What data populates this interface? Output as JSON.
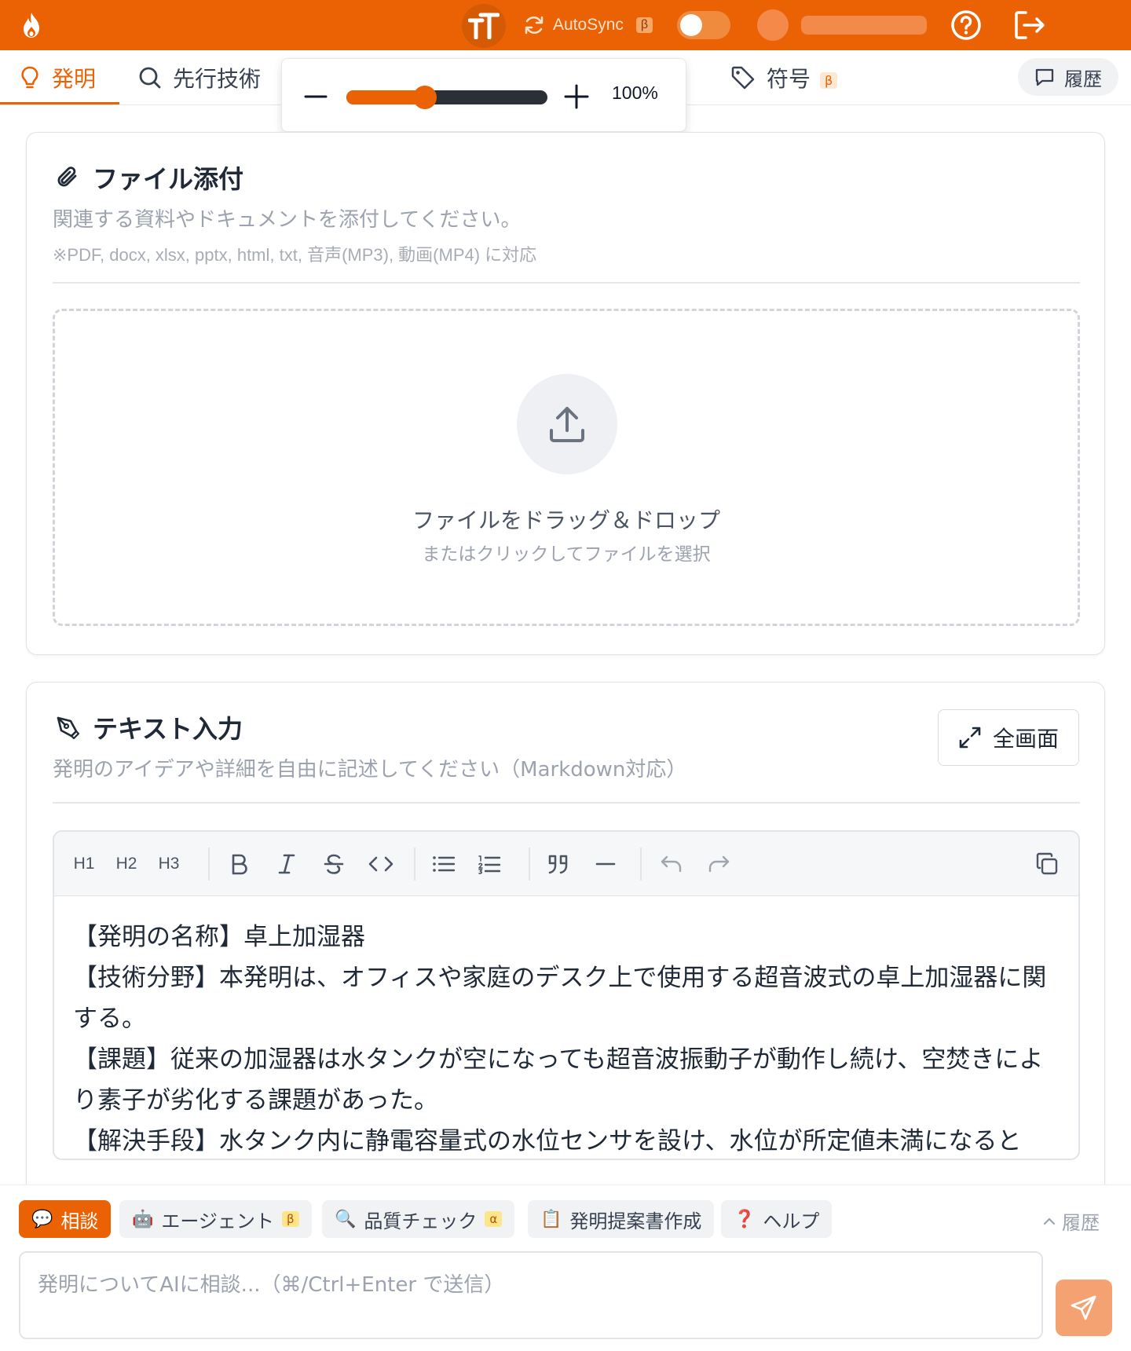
{
  "topbar": {
    "font_size_icon_text": "TT",
    "autosync_label": "AutoSync",
    "autosync_badge": "β",
    "autosync_enabled": false,
    "icons": [
      "fire-logo-icon",
      "font-size-icon",
      "sync-icon",
      "help-icon",
      "logout-icon"
    ]
  },
  "tabs": {
    "items": [
      {
        "label": "発明",
        "icon": "lightbulb-icon",
        "active": true
      },
      {
        "label": "先行技術",
        "icon": "search-icon"
      },
      {
        "label": "符号",
        "icon": "tag-icon",
        "badge": "β"
      }
    ],
    "history_label": "履歴"
  },
  "zoom": {
    "value_label": "100%",
    "level_fraction": 0.39
  },
  "attach": {
    "title": "ファイル添付",
    "description": "関連する資料やドキュメントを添付してください。",
    "note": "※PDF, docx, xlsx, pptx, html, txt, 音声(MP3), 動画(MP4) に対応",
    "drop_main": "ファイルをドラッグ＆ドロップ",
    "drop_sub": "またはクリックしてファイルを選択"
  },
  "text_input": {
    "title": "テキスト入力",
    "description": "発明のアイデアや詳細を自由に記述してください（Markdown対応）",
    "fullscreen_label": "全画面",
    "toolbar": {
      "h1": "H1",
      "h2": "H2",
      "h3": "H3"
    },
    "content": [
      "【発明の名称】卓上加湿器",
      "【技術分野】本発明は、オフィスや家庭のデスク上で使用する超音波式の卓上加湿器に関する。",
      "【課題】従来の加湿器は水タンクが空になっても超音波振動子が動作し続け、空焚きにより素子が劣化する課題があった。",
      "【解決手段】水タンク内に静電容量式の水位センサを設け、水位が所定値未満になると"
    ]
  },
  "chat": {
    "chips": [
      {
        "icon": "💬",
        "label": "相談",
        "active": true
      },
      {
        "icon": "🤖",
        "label": "エージェント",
        "badge": "β"
      },
      {
        "icon": "🔍",
        "label": "品質チェック",
        "badge": "α"
      },
      {
        "icon": "📋",
        "label": "発明提案書作成"
      },
      {
        "icon": "❓",
        "label": "ヘルプ"
      }
    ],
    "history_label": "履歴",
    "placeholder": "発明についてAIに相談...（⌘/Ctrl+Enter で送信）"
  },
  "colors": {
    "brand": "#ea6203",
    "send_button": "#f5a273"
  }
}
